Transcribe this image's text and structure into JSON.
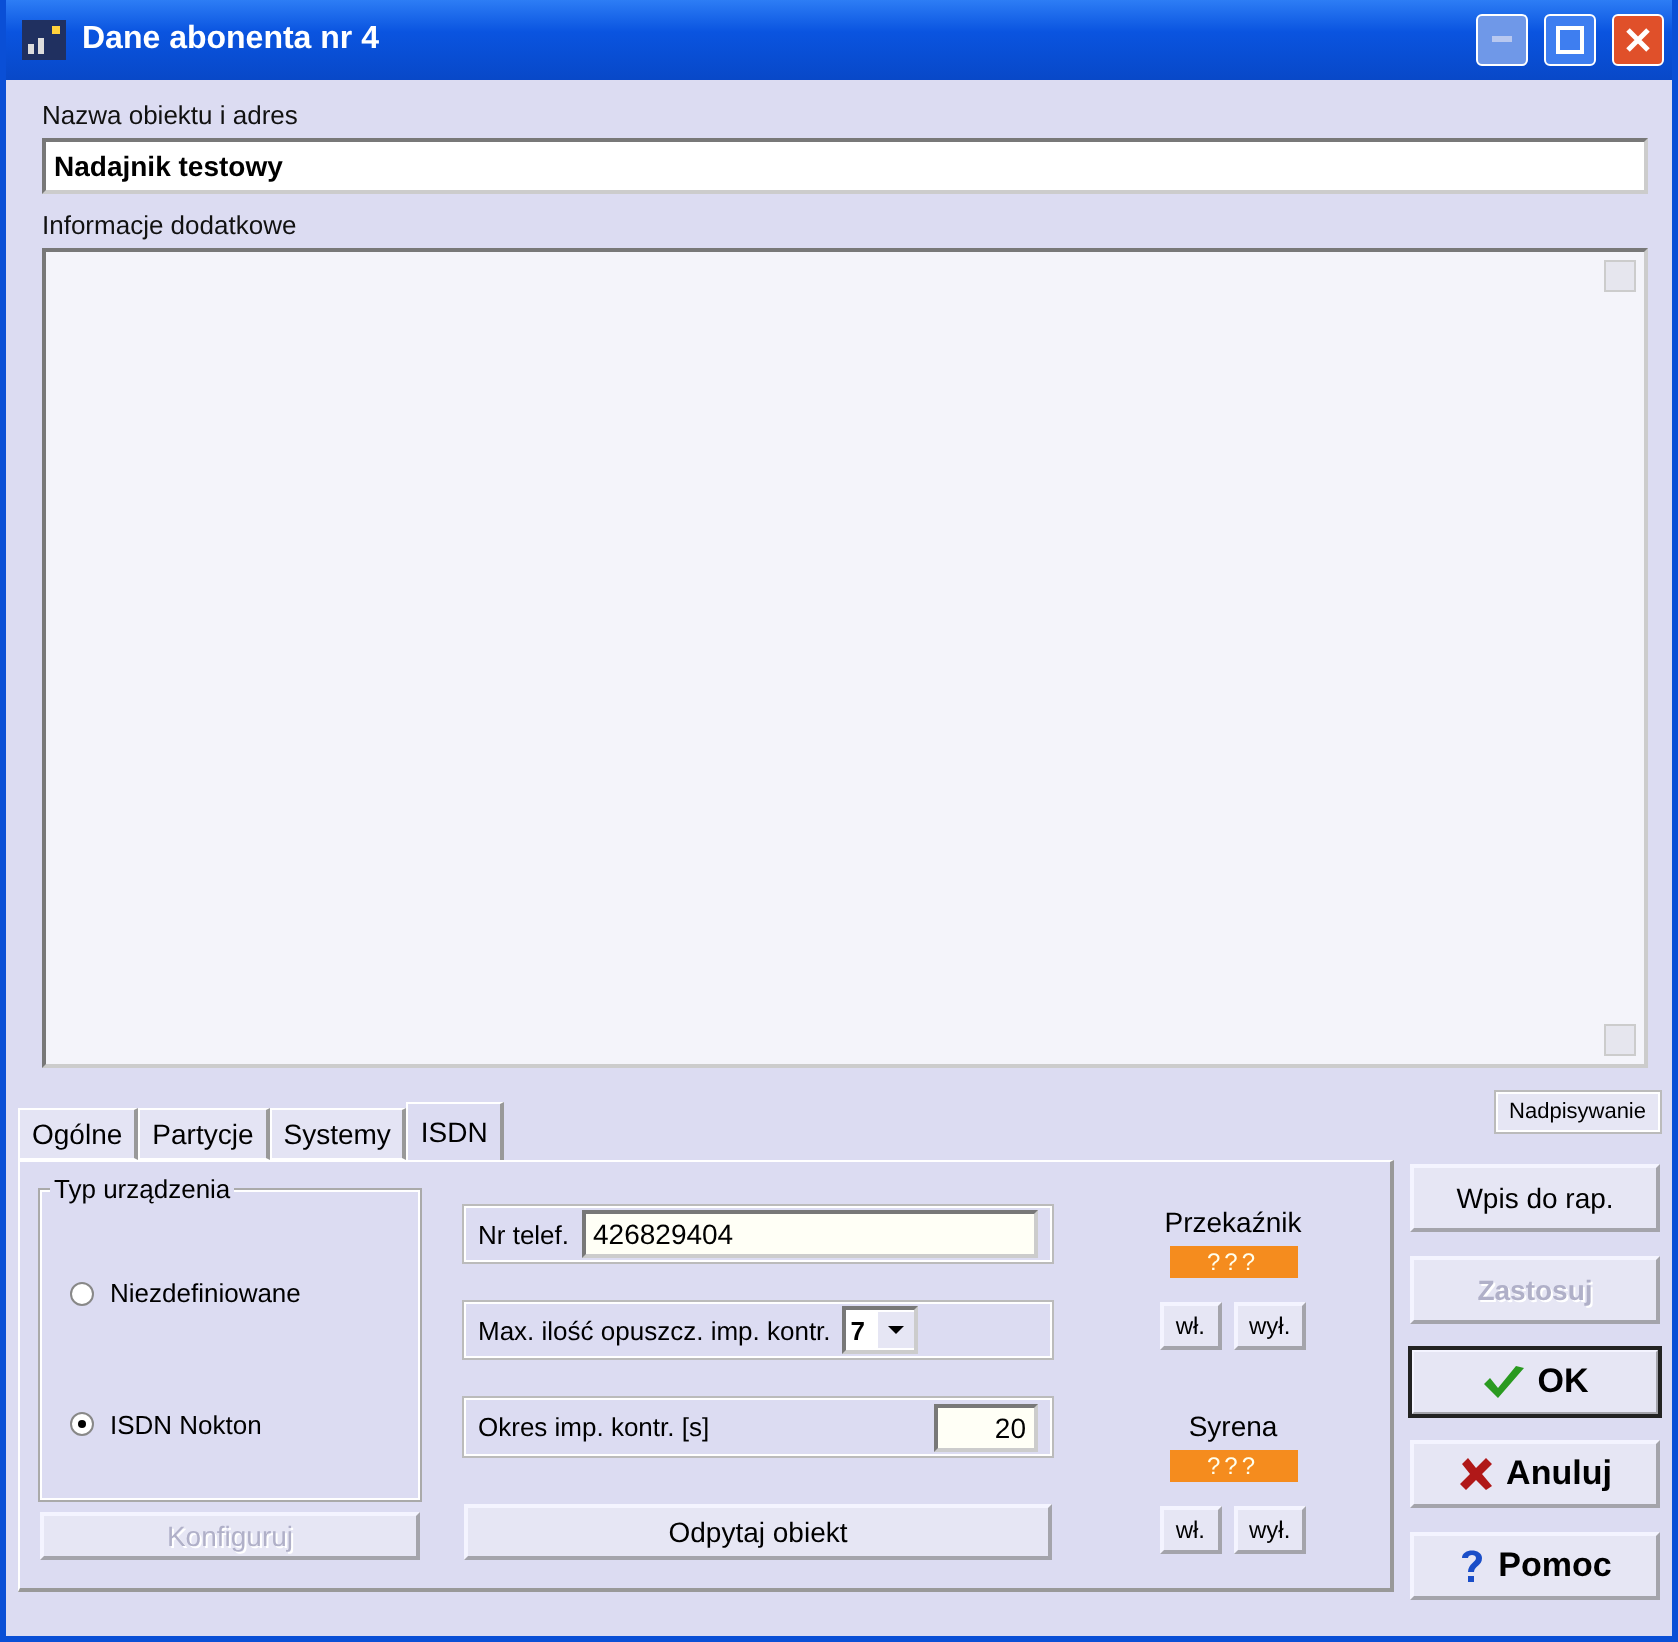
{
  "window": {
    "title": "Dane abonenta nr 4"
  },
  "name_field": {
    "label": "Nazwa obiektu i adres",
    "value": "Nadajnik testowy"
  },
  "info_field": {
    "label": "Informacje dodatkowe"
  },
  "tabs": [
    {
      "label": "Ogólne",
      "selected": false
    },
    {
      "label": "Partycje",
      "selected": false
    },
    {
      "label": "Systemy",
      "selected": false
    },
    {
      "label": "ISDN",
      "selected": true
    }
  ],
  "device_type": {
    "title": "Typ urządzenia",
    "options": [
      {
        "label": "Niezdefiniowane",
        "selected": false
      },
      {
        "label": "ISDN Nokton",
        "selected": true
      }
    ],
    "configure_button": {
      "label": "Konfiguruj",
      "disabled": true
    }
  },
  "phone": {
    "label": "Nr telef.",
    "value": "426829404"
  },
  "max_missed": {
    "label": "Max. ilość opuszcz. imp. kontr.",
    "value": "7"
  },
  "period": {
    "label": "Okres imp. kontr. [s]",
    "value": "20"
  },
  "query_button": "Odpytaj obiekt",
  "outputs": [
    {
      "label": "Przekaźnik",
      "status": "???",
      "on_button": "wł.",
      "off_button": "wył."
    },
    {
      "label": "Syrena",
      "status": "???",
      "on_button": "wł.",
      "off_button": "wył."
    }
  ],
  "mode_indicator": "Nadpisywanie",
  "buttons": [
    {
      "label": "Wpis do rap.",
      "kind": "plain",
      "disabled": false,
      "focused": false
    },
    {
      "label": "Zastosuj",
      "kind": "plain",
      "disabled": true,
      "focused": false
    },
    {
      "label": "OK",
      "kind": "ok",
      "disabled": false,
      "focused": true
    },
    {
      "label": "Anuluj",
      "kind": "cancel",
      "disabled": false,
      "focused": false
    },
    {
      "label": "Pomoc",
      "kind": "help",
      "disabled": false,
      "focused": false
    }
  ]
}
